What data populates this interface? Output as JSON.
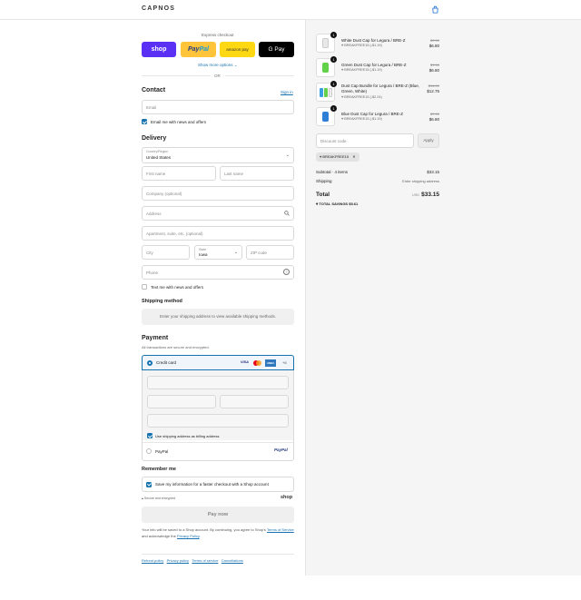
{
  "header": {
    "brand": "CAPNOS",
    "bag_icon": "shopping-bag-icon"
  },
  "express": {
    "label": "Express checkout",
    "shop": "shop",
    "paypal_pay": "Pay",
    "paypal_pal": "Pal",
    "amazon": "amazon pay",
    "gpay": "G Pay",
    "more": "Show more options",
    "or": "OR"
  },
  "contact": {
    "title": "Contact",
    "sign_in": "Sign in",
    "email_placeholder": "Email",
    "news_label": "Email me with news and offers"
  },
  "delivery": {
    "title": "Delivery",
    "country_label": "Country/Region",
    "country_value": "United States",
    "first_name": "First name",
    "last_name": "Last name",
    "company": "Company (optional)",
    "address": "Address",
    "apartment": "Apartment, suite, etc. (optional)",
    "city": "City",
    "state_label": "State",
    "state_value": "Iowa",
    "zip": "ZIP code",
    "phone": "Phone",
    "text_label": "Text me with news and offers"
  },
  "shipping": {
    "title": "Shipping method",
    "message": "Enter your shipping address to view available shipping methods."
  },
  "payment": {
    "title": "Payment",
    "subtitle": "All transactions are secure and encrypted.",
    "credit_card": "Credit card",
    "cards": [
      "VISA",
      "MC",
      "AMEX"
    ],
    "more_cards": "+5",
    "billing_label": "Use shipping address as billing address",
    "paypal": "PayPal"
  },
  "remember": {
    "title": "Remember me",
    "save_label": "Save my information for a faster checkout with a Shop account",
    "secure": "Secure and encrypted",
    "shop": "shop"
  },
  "pay_now": "Pay now",
  "legal": {
    "line1": "Your info will be saved to a Shop account. By continuing, you agree to Shop's",
    "tos": "Terms of Service",
    "and": "and acknowledge the",
    "privacy": "Privacy Policy",
    "end": "."
  },
  "footer_links": [
    "Refund policy",
    "Privacy policy",
    "Terms of service",
    "Cancellations"
  ],
  "order": {
    "items": [
      {
        "title": "White Dust Cap for Legura / BRE-Z",
        "discount": "BREAKFREE15 (-$1.19)",
        "old": "$7.99",
        "price": "$6.80",
        "qty": "1",
        "color": "#e8e8e8"
      },
      {
        "title": "Green Dust Cap for Legura / BRE-Z",
        "discount": "BREAKFREE15 (-$1.19)",
        "old": "$7.99",
        "price": "$6.80",
        "qty": "1",
        "color": "#63d24a"
      },
      {
        "title": "Dust Cap Bundle for Legura / BRE-Z (Blue, Green, White)",
        "discount": "BREAKFREE15 (-$2.24)",
        "old": "$14.99",
        "price": "$12.75",
        "qty": "1",
        "color": "#3aa0e0"
      },
      {
        "title": "Blue Dust Cap for Legura / BRE-Z",
        "discount": "BREAKFREE15 (-$1.19)",
        "old": "$7.99",
        "price": "$6.80",
        "qty": "1",
        "color": "#2f7fd6"
      }
    ],
    "discount_placeholder": "Discount code",
    "apply": "Apply",
    "code_tag": "BREAKFREE15",
    "subtotal_label": "Subtotal · 4 items",
    "subtotal": "$33.15",
    "shipping_label": "Shipping",
    "shipping_value": "Enter shipping address",
    "total_label": "Total",
    "currency": "USD",
    "total": "$33.15",
    "savings_label": "TOTAL SAVINGS",
    "savings": "$5.61"
  }
}
